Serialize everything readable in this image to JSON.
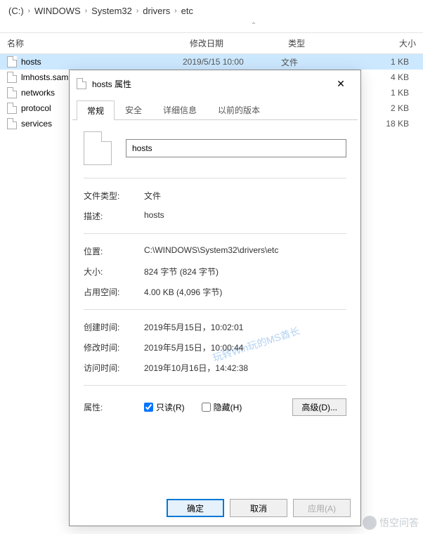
{
  "breadcrumb": {
    "p0": "(C:)",
    "p1": "WINDOWS",
    "p2": "System32",
    "p3": "drivers",
    "p4": "etc"
  },
  "headers": {
    "name": "名称",
    "date": "修改日期",
    "type": "类型",
    "size": "大小"
  },
  "files": [
    {
      "name": "hosts",
      "date": "2019/5/15 10:00",
      "type": "文件",
      "size": "1 KB"
    },
    {
      "name": "lmhosts.sam",
      "date": "",
      "type": "",
      "size": "4 KB"
    },
    {
      "name": "networks",
      "date": "",
      "type": "",
      "size": "1 KB"
    },
    {
      "name": "protocol",
      "date": "",
      "type": "",
      "size": "2 KB"
    },
    {
      "name": "services",
      "date": "",
      "type": "",
      "size": "18 KB"
    }
  ],
  "dialog": {
    "title": "hosts 属性",
    "tabs": {
      "general": "常规",
      "security": "安全",
      "details": "详细信息",
      "prev": "以前的版本"
    },
    "filename": "hosts",
    "labels": {
      "filetype": "文件类型:",
      "desc": "描述:",
      "location": "位置:",
      "size": "大小:",
      "ondisk": "占用空间:",
      "created": "创建时间:",
      "modified": "修改时间:",
      "accessed": "访问时间:",
      "attrs": "属性:",
      "readonly": "只读(R)",
      "hidden": "隐藏(H)",
      "advanced": "高级(D)..."
    },
    "values": {
      "filetype": "文件",
      "desc": "hosts",
      "location": "C:\\WINDOWS\\System32\\drivers\\etc",
      "size": "824 字节 (824 字节)",
      "ondisk": "4.00 KB (4,096 字节)",
      "created": "2019年5月15日，10:02:01",
      "modified": "2019年5月15日，10:00:44",
      "accessed": "2019年10月16日，14:42:38"
    },
    "buttons": {
      "ok": "确定",
      "cancel": "取消",
      "apply": "应用(A)"
    },
    "readonly_checked": true,
    "hidden_checked": false
  },
  "watermark": {
    "diag": "玩转Win玩的MS酋长",
    "corner": "悟空问答"
  }
}
